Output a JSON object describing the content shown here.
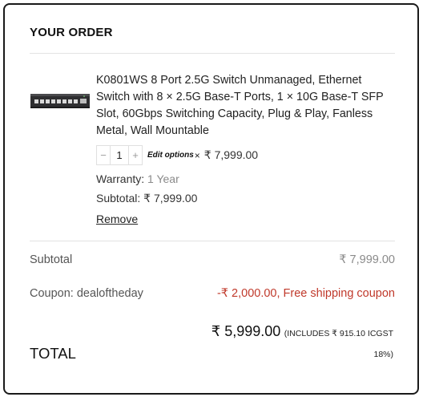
{
  "order": {
    "heading": "YOUR ORDER"
  },
  "product": {
    "title": "K0801WS 8 Port 2.5G Switch Unmanaged, Ethernet Switch with 8 × 2.5G Base-T Ports, 1 × 10G Base-T SFP Slot, 60Gbps Switching Capacity, Plug & Play, Fanless Metal, Wall Mountable",
    "image_icon": "network-switch-icon",
    "quantity": "1",
    "minus_label": "−",
    "plus_label": "+",
    "edit_options_label": "Edit options",
    "times_symbol": "×",
    "unit_price": "₹ 7,999.00",
    "warranty_label": "Warranty:",
    "warranty_value": "1 Year",
    "subtotal_line": "Subtotal: ₹ 7,999.00",
    "remove_label": "Remove"
  },
  "summary": {
    "subtotal_label": "Subtotal",
    "subtotal_value": "₹ 7,999.00",
    "coupon_label": "Coupon: dealoftheday",
    "coupon_value": "-₹ 2,000.00, Free shipping coupon",
    "total_label": "TOTAL",
    "total_value": "₹ 5,999.00",
    "tax_note": "(INCLUDES ₹ 915.10 ICGST 18%)"
  },
  "colors": {
    "coupon": "#c0392b",
    "muted": "#8a8a8a",
    "border": "#1a1a1a"
  }
}
